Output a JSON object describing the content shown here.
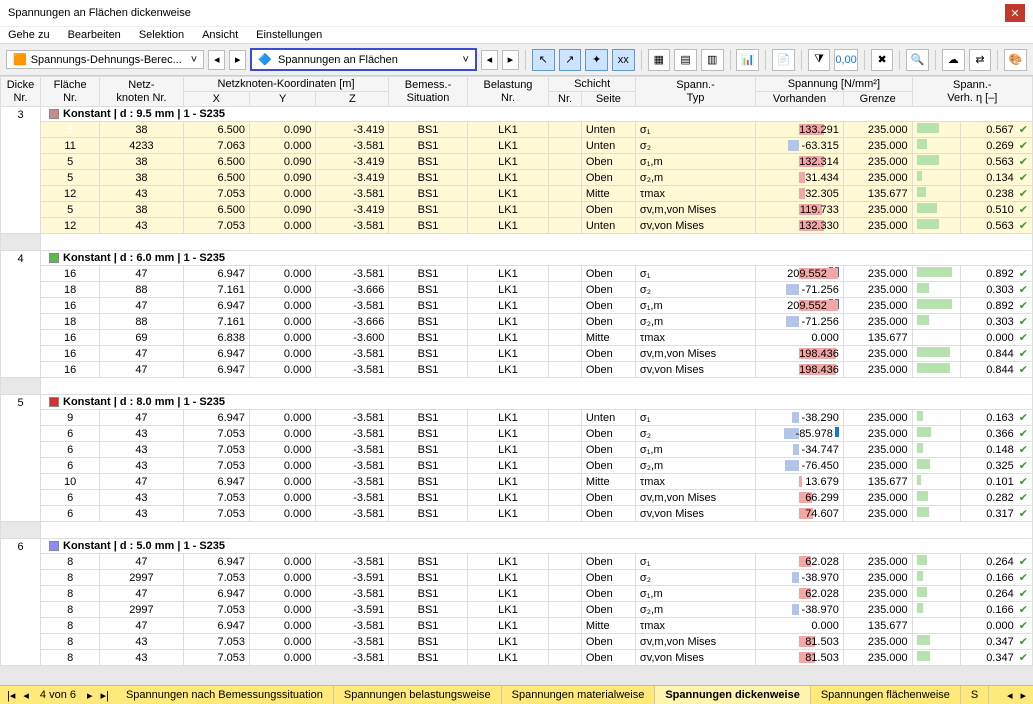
{
  "window_title": "Spannungen an Flächen dickenweise",
  "menu": [
    "Gehe zu",
    "Bearbeiten",
    "Selektion",
    "Ansicht",
    "Einstellungen"
  ],
  "dropdown1": "Spannungs-Dehnungs-Berec...",
  "dropdown2": "Spannungen an Flächen",
  "columns": {
    "dicke": "Dicke\nNr.",
    "flaeche": "Fläche\nNr.",
    "netz": "Netz-\nknoten Nr.",
    "koord": "Netzknoten-Koordinaten [m]",
    "x": "X",
    "y": "Y",
    "z": "Z",
    "bemess": "Bemess.-\nSituation",
    "belast": "Belastung\nNr.",
    "schicht": "Schicht",
    "schicht_nr": "Nr.",
    "seite": "Seite",
    "spann_typ": "Spann.-\nTyp",
    "spann": "Spannung [N/mm²]",
    "vorh": "Vorhanden",
    "grenze": "Grenze",
    "verh": "Spann.-\nVerh. η [–]"
  },
  "groups": [
    {
      "dicke": "3",
      "color": "#c98b8b",
      "label": "Konstant | d : 9.5 mm | 1 - S235",
      "highlight": true,
      "rows": [
        {
          "fl": "5",
          "nk": "38",
          "x": "6.500",
          "y": "0.090",
          "z": "-3.419",
          "bs": "BS1",
          "lk": "LK1",
          "seite": "Unten",
          "typ": "σ₁",
          "v": 133.291,
          "g": 235.0,
          "r": 0.567,
          "sel": true
        },
        {
          "fl": "11",
          "nk": "4233",
          "x": "7.063",
          "y": "0.000",
          "z": "-3.581",
          "bs": "BS1",
          "lk": "LK1",
          "seite": "Unten",
          "typ": "σ₂",
          "v": -63.315,
          "g": 235.0,
          "r": 0.269
        },
        {
          "fl": "5",
          "nk": "38",
          "x": "6.500",
          "y": "0.090",
          "z": "-3.419",
          "bs": "BS1",
          "lk": "LK1",
          "seite": "Oben",
          "typ": "σ₁,m",
          "v": 132.314,
          "g": 235.0,
          "r": 0.563
        },
        {
          "fl": "5",
          "nk": "38",
          "x": "6.500",
          "y": "0.090",
          "z": "-3.419",
          "bs": "BS1",
          "lk": "LK1",
          "seite": "Oben",
          "typ": "σ₂,m",
          "v": 31.434,
          "g": 235.0,
          "r": 0.134
        },
        {
          "fl": "12",
          "nk": "43",
          "x": "7.053",
          "y": "0.000",
          "z": "-3.581",
          "bs": "BS1",
          "lk": "LK1",
          "seite": "Mitte",
          "typ": "τmax",
          "v": 32.305,
          "g": 135.677,
          "r": 0.238
        },
        {
          "fl": "5",
          "nk": "38",
          "x": "6.500",
          "y": "0.090",
          "z": "-3.419",
          "bs": "BS1",
          "lk": "LK1",
          "seite": "Oben",
          "typ": "σv,m,von Mises",
          "v": 119.733,
          "g": 235.0,
          "r": 0.51
        },
        {
          "fl": "12",
          "nk": "43",
          "x": "7.053",
          "y": "0.000",
          "z": "-3.581",
          "bs": "BS1",
          "lk": "LK1",
          "seite": "Unten",
          "typ": "σv,von Mises",
          "v": 132.33,
          "g": 235.0,
          "r": 0.563
        }
      ]
    },
    {
      "dicke": "4",
      "color": "#5fb84e",
      "label": "Konstant | d : 6.0 mm | 1 - S235",
      "rows": [
        {
          "fl": "16",
          "nk": "47",
          "x": "6.947",
          "y": "0.000",
          "z": "-3.581",
          "bs": "BS1",
          "lk": "LK1",
          "seite": "Oben",
          "typ": "σ₁",
          "v": 209.552,
          "g": 235.0,
          "r": 0.892,
          "mark": "both"
        },
        {
          "fl": "18",
          "nk": "88",
          "x": "7.161",
          "y": "0.000",
          "z": "-3.666",
          "bs": "BS1",
          "lk": "LK1",
          "seite": "Oben",
          "typ": "σ₂",
          "v": -71.256,
          "g": 235.0,
          "r": 0.303
        },
        {
          "fl": "16",
          "nk": "47",
          "x": "6.947",
          "y": "0.000",
          "z": "-3.581",
          "bs": "BS1",
          "lk": "LK1",
          "seite": "Oben",
          "typ": "σ₁,m",
          "v": 209.552,
          "g": 235.0,
          "r": 0.892,
          "mark": "both"
        },
        {
          "fl": "18",
          "nk": "88",
          "x": "7.161",
          "y": "0.000",
          "z": "-3.666",
          "bs": "BS1",
          "lk": "LK1",
          "seite": "Oben",
          "typ": "σ₂,m",
          "v": -71.256,
          "g": 235.0,
          "r": 0.303
        },
        {
          "fl": "16",
          "nk": "69",
          "x": "6.838",
          "y": "0.000",
          "z": "-3.600",
          "bs": "BS1",
          "lk": "LK1",
          "seite": "Mitte",
          "typ": "τmax",
          "v": 0.0,
          "g": 135.677,
          "r": 0.0
        },
        {
          "fl": "16",
          "nk": "47",
          "x": "6.947",
          "y": "0.000",
          "z": "-3.581",
          "bs": "BS1",
          "lk": "LK1",
          "seite": "Oben",
          "typ": "σv,m,von Mises",
          "v": 198.436,
          "g": 235.0,
          "r": 0.844
        },
        {
          "fl": "16",
          "nk": "47",
          "x": "6.947",
          "y": "0.000",
          "z": "-3.581",
          "bs": "BS1",
          "lk": "LK1",
          "seite": "Oben",
          "typ": "σv,von Mises",
          "v": 198.436,
          "g": 235.0,
          "r": 0.844
        }
      ]
    },
    {
      "dicke": "5",
      "color": "#d73030",
      "label": "Konstant | d : 8.0 mm | 1 - S235",
      "rows": [
        {
          "fl": "9",
          "nk": "47",
          "x": "6.947",
          "y": "0.000",
          "z": "-3.581",
          "bs": "BS1",
          "lk": "LK1",
          "seite": "Unten",
          "typ": "σ₁",
          "v": -38.29,
          "g": 235.0,
          "r": 0.163
        },
        {
          "fl": "6",
          "nk": "43",
          "x": "7.053",
          "y": "0.000",
          "z": "-3.581",
          "bs": "BS1",
          "lk": "LK1",
          "seite": "Oben",
          "typ": "σ₂",
          "v": -85.978,
          "g": 235.0,
          "r": 0.366,
          "mark": "blue"
        },
        {
          "fl": "6",
          "nk": "43",
          "x": "7.053",
          "y": "0.000",
          "z": "-3.581",
          "bs": "BS1",
          "lk": "LK1",
          "seite": "Oben",
          "typ": "σ₁,m",
          "v": -34.747,
          "g": 235.0,
          "r": 0.148
        },
        {
          "fl": "6",
          "nk": "43",
          "x": "7.053",
          "y": "0.000",
          "z": "-3.581",
          "bs": "BS1",
          "lk": "LK1",
          "seite": "Oben",
          "typ": "σ₂,m",
          "v": -76.45,
          "g": 235.0,
          "r": 0.325
        },
        {
          "fl": "10",
          "nk": "47",
          "x": "6.947",
          "y": "0.000",
          "z": "-3.581",
          "bs": "BS1",
          "lk": "LK1",
          "seite": "Mitte",
          "typ": "τmax",
          "v": 13.679,
          "g": 135.677,
          "r": 0.101
        },
        {
          "fl": "6",
          "nk": "43",
          "x": "7.053",
          "y": "0.000",
          "z": "-3.581",
          "bs": "BS1",
          "lk": "LK1",
          "seite": "Oben",
          "typ": "σv,m,von Mises",
          "v": 66.299,
          "g": 235.0,
          "r": 0.282
        },
        {
          "fl": "6",
          "nk": "43",
          "x": "7.053",
          "y": "0.000",
          "z": "-3.581",
          "bs": "BS1",
          "lk": "LK1",
          "seite": "Oben",
          "typ": "σv,von Mises",
          "v": 74.607,
          "g": 235.0,
          "r": 0.317
        }
      ]
    },
    {
      "dicke": "6",
      "color": "#8a8aff",
      "label": "Konstant | d : 5.0 mm | 1 - S235",
      "rows": [
        {
          "fl": "8",
          "nk": "47",
          "x": "6.947",
          "y": "0.000",
          "z": "-3.581",
          "bs": "BS1",
          "lk": "LK1",
          "seite": "Oben",
          "typ": "σ₁",
          "v": 62.028,
          "g": 235.0,
          "r": 0.264
        },
        {
          "fl": "8",
          "nk": "2997",
          "x": "7.053",
          "y": "0.000",
          "z": "-3.591",
          "bs": "BS1",
          "lk": "LK1",
          "seite": "Oben",
          "typ": "σ₂",
          "v": -38.97,
          "g": 235.0,
          "r": 0.166
        },
        {
          "fl": "8",
          "nk": "47",
          "x": "6.947",
          "y": "0.000",
          "z": "-3.581",
          "bs": "BS1",
          "lk": "LK1",
          "seite": "Oben",
          "typ": "σ₁,m",
          "v": 62.028,
          "g": 235.0,
          "r": 0.264
        },
        {
          "fl": "8",
          "nk": "2997",
          "x": "7.053",
          "y": "0.000",
          "z": "-3.591",
          "bs": "BS1",
          "lk": "LK1",
          "seite": "Oben",
          "typ": "σ₂,m",
          "v": -38.97,
          "g": 235.0,
          "r": 0.166
        },
        {
          "fl": "8",
          "nk": "47",
          "x": "6.947",
          "y": "0.000",
          "z": "-3.581",
          "bs": "BS1",
          "lk": "LK1",
          "seite": "Mitte",
          "typ": "τmax",
          "v": 0.0,
          "g": 135.677,
          "r": 0.0
        },
        {
          "fl": "8",
          "nk": "43",
          "x": "7.053",
          "y": "0.000",
          "z": "-3.581",
          "bs": "BS1",
          "lk": "LK1",
          "seite": "Oben",
          "typ": "σv,m,von Mises",
          "v": 81.503,
          "g": 235.0,
          "r": 0.347
        },
        {
          "fl": "8",
          "nk": "43",
          "x": "7.053",
          "y": "0.000",
          "z": "-3.581",
          "bs": "BS1",
          "lk": "LK1",
          "seite": "Oben",
          "typ": "σv,von Mises",
          "v": 81.503,
          "g": 235.0,
          "r": 0.347
        }
      ]
    }
  ],
  "footer": {
    "page": "4 von 6",
    "tabs": [
      "Spannungen nach Bemessungssituation",
      "Spannungen belastungsweise",
      "Spannungen materialweise",
      "Spannungen dickenweise",
      "Spannungen flächenweise",
      "S"
    ],
    "active": 3
  }
}
